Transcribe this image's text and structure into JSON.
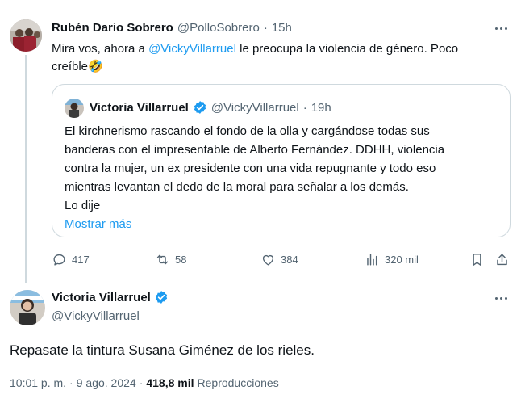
{
  "reply": {
    "author_name": "Rubén Dario Sobrero",
    "handle": "@PolloSobrero",
    "separator": "·",
    "time": "15h",
    "text_before": "Mira vos, ahora a ",
    "mention": "@VickyVillarruel",
    "text_line1_after": " le preocupa la violencia de género. Poco",
    "text_line2": "creíble",
    "emoji": "🤣",
    "quote": {
      "author_name": "Victoria Villarruel",
      "handle": "@VickyVillarruel",
      "separator": "·",
      "time": "19h",
      "lines": [
        "El kirchnerismo rascando el fondo de la olla y cargándose todas sus",
        "banderas con el impresentable de Alberto Fernández. DDHH, violencia",
        "contra la mujer, un ex presidente con una vida repugnante y todo eso",
        "mientras levantan el dedo de la moral para señalar a los demás.",
        "Lo dije"
      ],
      "show_more": "Mostrar más"
    },
    "actions": {
      "replies": "417",
      "reposts": "58",
      "likes": "384",
      "views": "320 mil"
    }
  },
  "main": {
    "author_name": "Victoria Villarruel",
    "handle": "@VickyVillarruel",
    "text": "Repasate la tintura Susana Giménez de los rieles.",
    "time": "10:01 p. m.",
    "separator": "·",
    "date": "9 ago. 2024",
    "views_count": "418,8 mil",
    "views_label": "Reproducciones"
  },
  "colors": {
    "accent": "#1d9bf0",
    "text": "#0f1419",
    "muted": "#536471",
    "border": "#cfd9de"
  }
}
